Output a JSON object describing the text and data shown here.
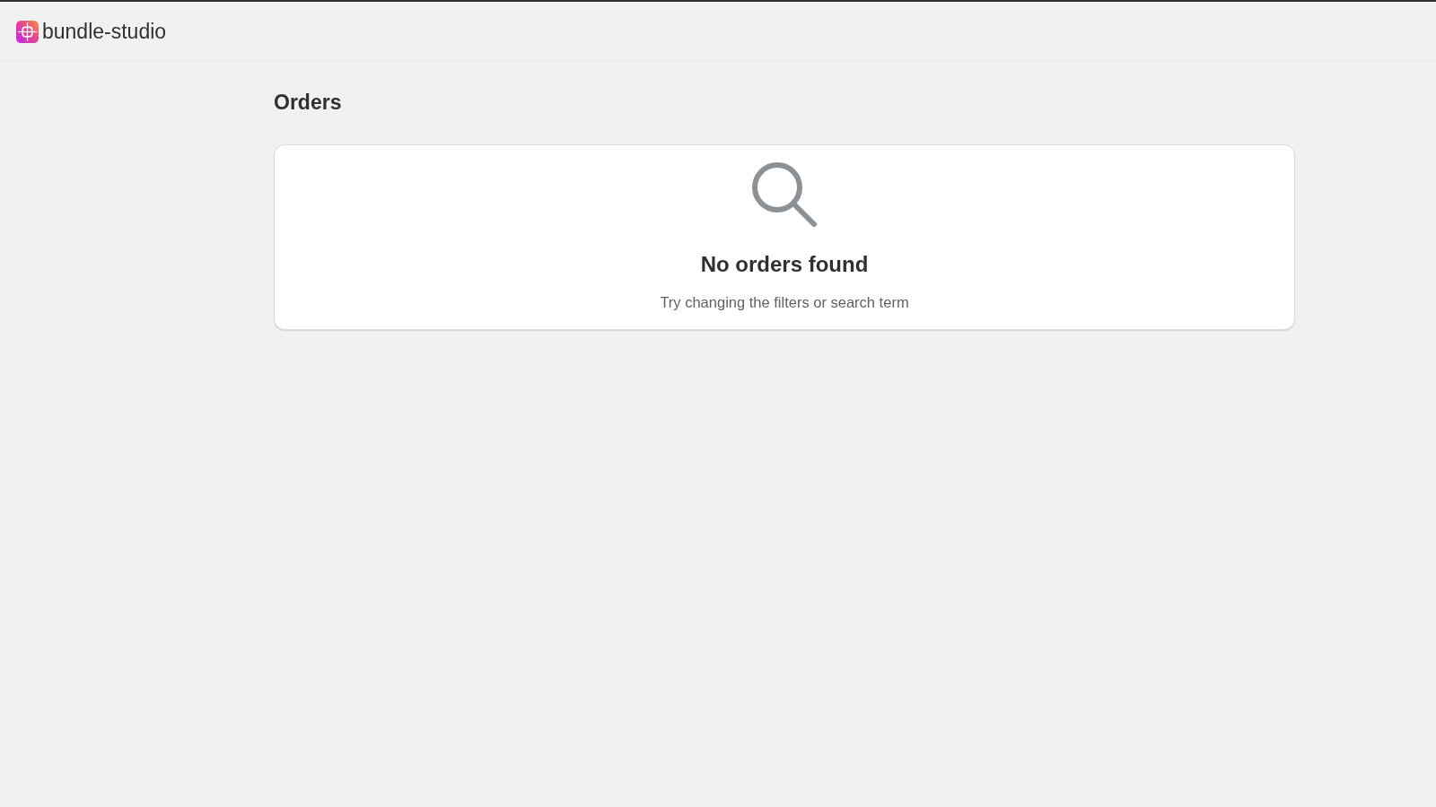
{
  "header": {
    "app_name": "bundle-studio"
  },
  "page": {
    "title": "Orders"
  },
  "empty_state": {
    "title": "No orders found",
    "message": "Try changing the filters or search term"
  }
}
